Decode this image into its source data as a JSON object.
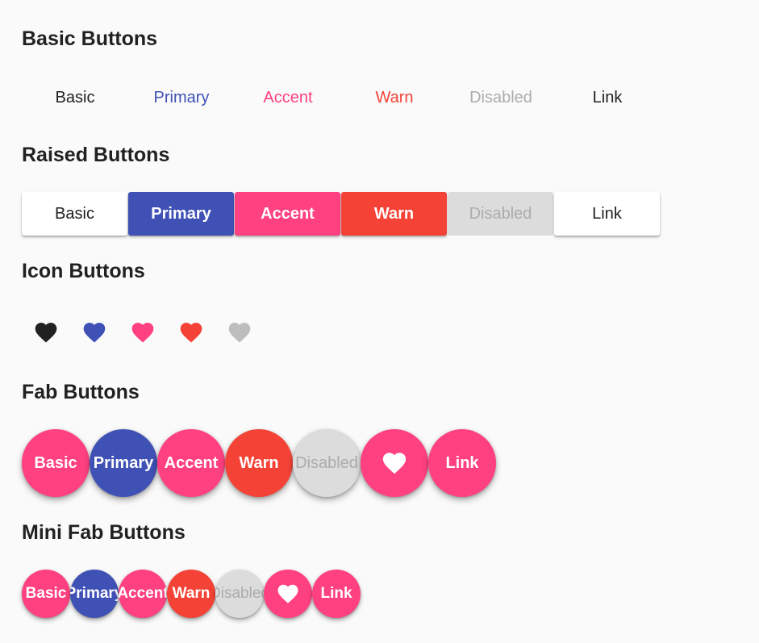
{
  "colors": {
    "text": "#212121",
    "primary": "#3f51b5",
    "accent": "#ff4081",
    "warn": "#f44336",
    "disabled_text": "#acacac",
    "disabled_bg": "#dcdcdc",
    "white": "#ffffff"
  },
  "basic_section": {
    "title": "Basic Buttons",
    "buttons": [
      "Basic",
      "Primary",
      "Accent",
      "Warn",
      "Disabled",
      "Link"
    ]
  },
  "raised_section": {
    "title": "Raised Buttons",
    "buttons": [
      "Basic",
      "Primary",
      "Accent",
      "Warn",
      "Disabled",
      "Link"
    ]
  },
  "icon_section": {
    "title": "Icon Buttons",
    "icons": [
      "heart-icon",
      "heart-icon",
      "heart-icon",
      "heart-icon",
      "heart-icon"
    ]
  },
  "fab_section": {
    "title": "Fab Buttons",
    "buttons": [
      "Basic",
      "Primary",
      "Accent",
      "Warn",
      "Disabled",
      "",
      "Link"
    ]
  },
  "mini_fab_section": {
    "title": "Mini Fab Buttons",
    "buttons": [
      "Basic",
      "Primary",
      "Accent",
      "Warn",
      "Disabled",
      "",
      "Link"
    ]
  }
}
